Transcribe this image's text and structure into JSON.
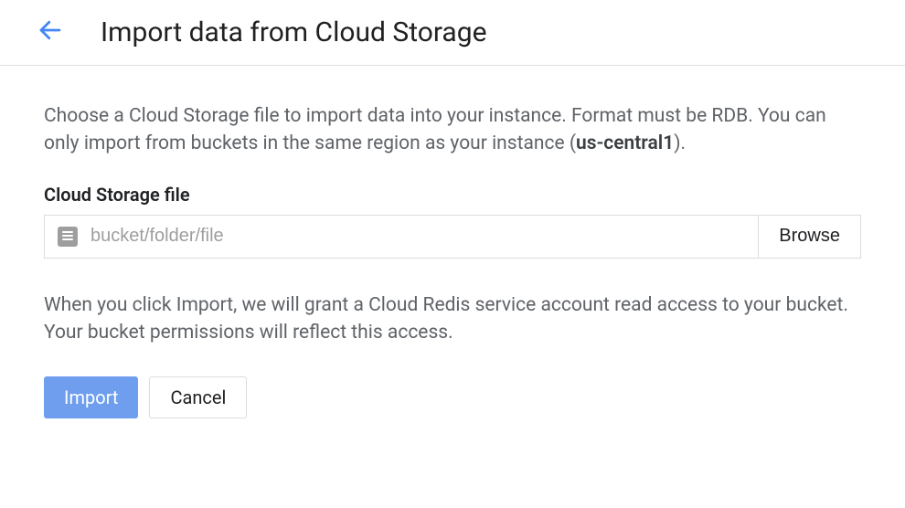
{
  "header": {
    "title": "Import data from Cloud Storage"
  },
  "content": {
    "description_part1": "Choose a Cloud Storage file to import data into your instance. Format must be RDB. You can only import from buckets in the same region as your instance (",
    "description_bold": "us-central1",
    "description_part2": ").",
    "field_label": "Cloud Storage file",
    "input_placeholder": "bucket/folder/file",
    "input_value": "",
    "browse_label": "Browse",
    "note": "When you click Import, we will grant a Cloud Redis service account read access to your bucket. Your bucket permissions will reflect this access."
  },
  "actions": {
    "primary_label": "Import",
    "secondary_label": "Cancel"
  }
}
